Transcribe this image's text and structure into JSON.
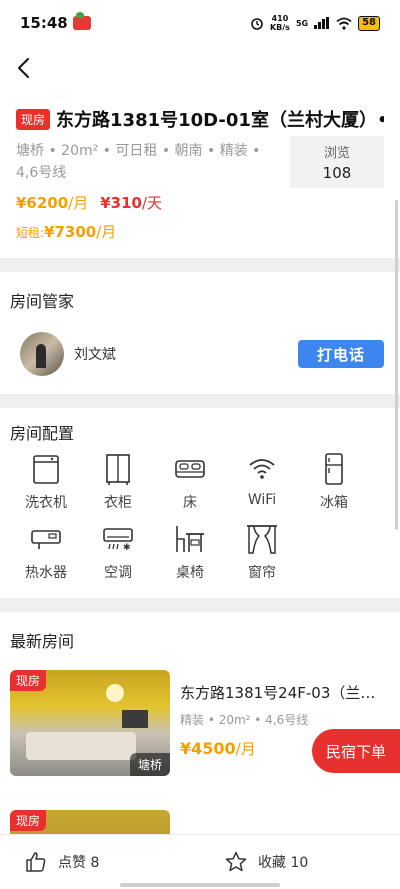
{
  "status_bar": {
    "time": "15:48",
    "speed_value": "410",
    "speed_unit": "KB/s",
    "network": "5G",
    "battery": "58"
  },
  "listing": {
    "tag": "现房",
    "title": "东方路1381号10D-01室（兰村大厦）•",
    "meta": "塘桥 • 20m² • 可日租 • 朝南 • 精装 • 4,6号线",
    "views_label": "浏览",
    "views_value": "108",
    "price_monthly": "¥6200",
    "price_monthly_unit": "/月",
    "price_daily": "¥310",
    "price_daily_unit": "/天",
    "short_label": "短租:",
    "short_price": "¥7300",
    "short_unit": "/月"
  },
  "agent_section": {
    "title": "房间管家",
    "agent_name": "刘文斌",
    "call_label": "打电话"
  },
  "facilities": {
    "title": "房间配置",
    "items": [
      {
        "label": "洗衣机",
        "icon": "washing-machine-icon"
      },
      {
        "label": "衣柜",
        "icon": "wardrobe-icon"
      },
      {
        "label": "床",
        "icon": "bed-icon"
      },
      {
        "label": "WiFi",
        "icon": "wifi-icon"
      },
      {
        "label": "冰箱",
        "icon": "fridge-icon"
      },
      {
        "label": "热水器",
        "icon": "water-heater-icon"
      },
      {
        "label": "空调",
        "icon": "air-conditioner-icon"
      },
      {
        "label": "桌椅",
        "icon": "table-chair-icon"
      },
      {
        "label": "窗帘",
        "icon": "curtain-icon"
      }
    ]
  },
  "latest": {
    "title": "最新房间",
    "items": [
      {
        "tag": "现房",
        "location": "塘桥",
        "title": "东方路1381号24F-03（兰…",
        "meta": "精装 • 20m² • 4,6号线",
        "price": "¥4500",
        "price_unit": "/月"
      },
      {
        "tag": "现房"
      }
    ]
  },
  "bnb_button": "民宿下单",
  "bottom_bar": {
    "like_label": "点赞 8",
    "fav_label": "收藏 10"
  },
  "colors": {
    "accent_red": "#e8312f",
    "accent_orange": "#f5a000",
    "call_blue": "#3d86f0"
  }
}
